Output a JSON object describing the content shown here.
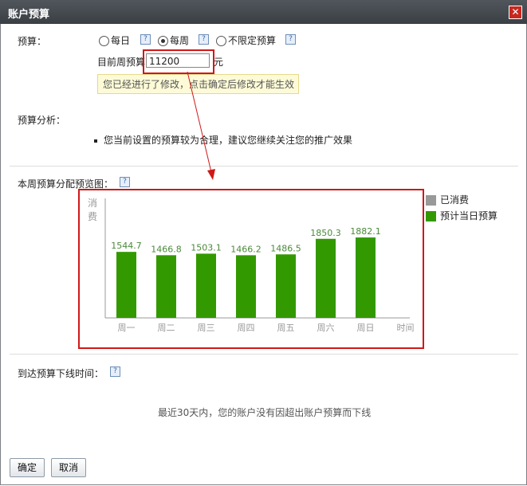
{
  "window": {
    "title": "账户预算",
    "close_icon": "close-icon"
  },
  "budget": {
    "label": "预算：",
    "options": [
      {
        "label": "每日",
        "selected": false
      },
      {
        "label": "每周",
        "selected": true
      },
      {
        "label": "不限定预算",
        "selected": false
      }
    ],
    "current_label": "目前周预算",
    "value": "11200",
    "unit": "元",
    "hint": "您已经进行了修改，点击确定后修改才能生效"
  },
  "analysis": {
    "label": "预算分析：",
    "item": "您当前设置的预算较为合理，建议您继续关注您的推广效果"
  },
  "preview": {
    "label": "本周预算分配预览图：",
    "legend": [
      {
        "label": "已消费",
        "color": "#999999"
      },
      {
        "label": "预计当日预算",
        "color": "#339900"
      }
    ]
  },
  "chart_data": {
    "type": "bar",
    "categories": [
      "周一",
      "周二",
      "周三",
      "周四",
      "周五",
      "周六",
      "周日"
    ],
    "series": [
      {
        "name": "预计当日预算",
        "values": [
          1544.7,
          1466.8,
          1503.1,
          1466.2,
          1486.5,
          1850.3,
          1882.1
        ]
      }
    ],
    "value_labels": [
      "1544.7",
      "1466.8",
      "1503.1",
      "1466.2",
      "1486.5",
      "1850.3",
      "1882.1"
    ],
    "ylabel": "消费",
    "xlabel": "时间",
    "bar_color": "#339900",
    "label_color": "#4a8a3a"
  },
  "offline": {
    "label": "到达预算下线时间：",
    "message": "最近30天内，您的账户没有因超出账户预算而下线"
  },
  "buttons": {
    "ok": "确定",
    "cancel": "取消"
  }
}
